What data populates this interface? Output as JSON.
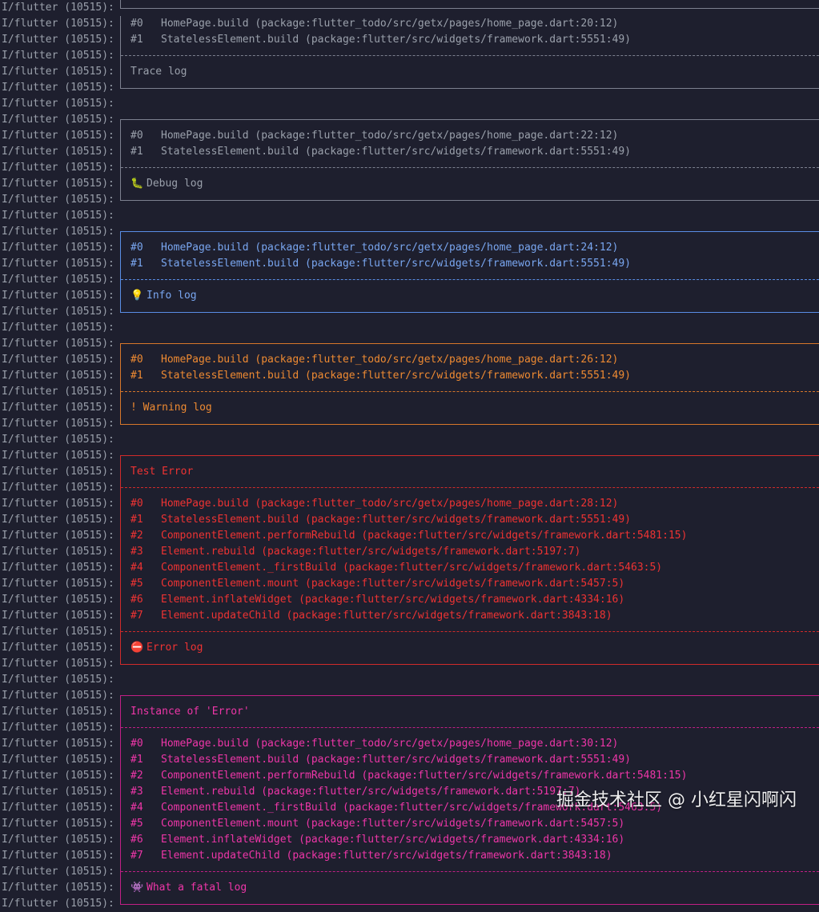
{
  "prefix": "I/flutter (10515):",
  "colors": {
    "trace": {
      "border": "#7d8190",
      "text": "#9aa0ab"
    },
    "debug": {
      "border": "#7d8190",
      "text": "#9aa0ab"
    },
    "info": {
      "border": "#5a8ee6",
      "text": "#79a6f0"
    },
    "warning": {
      "border": "#d8772a",
      "text": "#ee8a32"
    },
    "error": {
      "border": "#d12a2a",
      "text": "#ee3333"
    },
    "fatal": {
      "border": "#c21f86",
      "text": "#ee36a8"
    }
  },
  "lines": [
    {
      "kind": "bottom",
      "level": "trace"
    },
    {
      "kind": "frame",
      "level": "trace",
      "num": "#0",
      "text": "HomePage.build (package:flutter_todo/src/getx/pages/home_page.dart:20:12)"
    },
    {
      "kind": "frame",
      "level": "trace",
      "num": "#1",
      "text": "StatelessElement.build (package:flutter/src/widgets/framework.dart:5551:49)"
    },
    {
      "kind": "mid",
      "level": "trace"
    },
    {
      "kind": "msg",
      "level": "trace",
      "icon": "",
      "text": "Trace log"
    },
    {
      "kind": "bottom",
      "level": "trace"
    },
    {
      "kind": "blank"
    },
    {
      "kind": "top",
      "level": "debug"
    },
    {
      "kind": "frame",
      "level": "debug",
      "num": "#0",
      "text": "HomePage.build (package:flutter_todo/src/getx/pages/home_page.dart:22:12)"
    },
    {
      "kind": "frame",
      "level": "debug",
      "num": "#1",
      "text": "StatelessElement.build (package:flutter/src/widgets/framework.dart:5551:49)"
    },
    {
      "kind": "mid",
      "level": "debug"
    },
    {
      "kind": "msg",
      "level": "debug",
      "icon": "🐛",
      "text": "Debug log"
    },
    {
      "kind": "bottom",
      "level": "debug"
    },
    {
      "kind": "blank"
    },
    {
      "kind": "top",
      "level": "info"
    },
    {
      "kind": "frame",
      "level": "info",
      "num": "#0",
      "text": "HomePage.build (package:flutter_todo/src/getx/pages/home_page.dart:24:12)"
    },
    {
      "kind": "frame",
      "level": "info",
      "num": "#1",
      "text": "StatelessElement.build (package:flutter/src/widgets/framework.dart:5551:49)"
    },
    {
      "kind": "mid",
      "level": "info"
    },
    {
      "kind": "msg",
      "level": "info",
      "icon": "💡",
      "text": "Info log"
    },
    {
      "kind": "bottom",
      "level": "info"
    },
    {
      "kind": "blank"
    },
    {
      "kind": "top",
      "level": "warning"
    },
    {
      "kind": "frame",
      "level": "warning",
      "num": "#0",
      "text": "HomePage.build (package:flutter_todo/src/getx/pages/home_page.dart:26:12)"
    },
    {
      "kind": "frame",
      "level": "warning",
      "num": "#1",
      "text": "StatelessElement.build (package:flutter/src/widgets/framework.dart:5551:49)"
    },
    {
      "kind": "mid",
      "level": "warning"
    },
    {
      "kind": "msg",
      "level": "warning",
      "icon": "",
      "text": "! Warning log"
    },
    {
      "kind": "bottom",
      "level": "warning"
    },
    {
      "kind": "blank"
    },
    {
      "kind": "top",
      "level": "error"
    },
    {
      "kind": "msg",
      "level": "error",
      "icon": "",
      "text": "Test Error"
    },
    {
      "kind": "mid",
      "level": "error"
    },
    {
      "kind": "frame",
      "level": "error",
      "num": "#0",
      "text": "HomePage.build (package:flutter_todo/src/getx/pages/home_page.dart:28:12)"
    },
    {
      "kind": "frame",
      "level": "error",
      "num": "#1",
      "text": "StatelessElement.build (package:flutter/src/widgets/framework.dart:5551:49)"
    },
    {
      "kind": "frame",
      "level": "error",
      "num": "#2",
      "text": "ComponentElement.performRebuild (package:flutter/src/widgets/framework.dart:5481:15)"
    },
    {
      "kind": "frame",
      "level": "error",
      "num": "#3",
      "text": "Element.rebuild (package:flutter/src/widgets/framework.dart:5197:7)"
    },
    {
      "kind": "frame",
      "level": "error",
      "num": "#4",
      "text": "ComponentElement._firstBuild (package:flutter/src/widgets/framework.dart:5463:5)"
    },
    {
      "kind": "frame",
      "level": "error",
      "num": "#5",
      "text": "ComponentElement.mount (package:flutter/src/widgets/framework.dart:5457:5)"
    },
    {
      "kind": "frame",
      "level": "error",
      "num": "#6",
      "text": "Element.inflateWidget (package:flutter/src/widgets/framework.dart:4334:16)"
    },
    {
      "kind": "frame",
      "level": "error",
      "num": "#7",
      "text": "Element.updateChild (package:flutter/src/widgets/framework.dart:3843:18)"
    },
    {
      "kind": "mid",
      "level": "error"
    },
    {
      "kind": "msg",
      "level": "error",
      "icon": "⛔",
      "text": "Error log"
    },
    {
      "kind": "bottom",
      "level": "error"
    },
    {
      "kind": "blank"
    },
    {
      "kind": "top",
      "level": "fatal"
    },
    {
      "kind": "msg",
      "level": "fatal",
      "icon": "",
      "text": "Instance of 'Error'"
    },
    {
      "kind": "mid",
      "level": "fatal"
    },
    {
      "kind": "frame",
      "level": "fatal",
      "num": "#0",
      "text": "HomePage.build (package:flutter_todo/src/getx/pages/home_page.dart:30:12)"
    },
    {
      "kind": "frame",
      "level": "fatal",
      "num": "#1",
      "text": "StatelessElement.build (package:flutter/src/widgets/framework.dart:5551:49)"
    },
    {
      "kind": "frame",
      "level": "fatal",
      "num": "#2",
      "text": "ComponentElement.performRebuild (package:flutter/src/widgets/framework.dart:5481:15)"
    },
    {
      "kind": "frame",
      "level": "fatal",
      "num": "#3",
      "text": "Element.rebuild (package:flutter/src/widgets/framework.dart:5197:7)"
    },
    {
      "kind": "frame",
      "level": "fatal",
      "num": "#4",
      "text": "ComponentElement._firstBuild (package:flutter/src/widgets/framework.dart:5463:5)"
    },
    {
      "kind": "frame",
      "level": "fatal",
      "num": "#5",
      "text": "ComponentElement.mount (package:flutter/src/widgets/framework.dart:5457:5)"
    },
    {
      "kind": "frame",
      "level": "fatal",
      "num": "#6",
      "text": "Element.inflateWidget (package:flutter/src/widgets/framework.dart:4334:16)"
    },
    {
      "kind": "frame",
      "level": "fatal",
      "num": "#7",
      "text": "Element.updateChild (package:flutter/src/widgets/framework.dart:3843:18)"
    },
    {
      "kind": "mid",
      "level": "fatal"
    },
    {
      "kind": "msg",
      "level": "fatal",
      "icon": "👾",
      "text": "What a fatal log"
    },
    {
      "kind": "bottom",
      "level": "fatal"
    }
  ],
  "watermark": "掘金技术社区 @ 小红星闪啊闪"
}
